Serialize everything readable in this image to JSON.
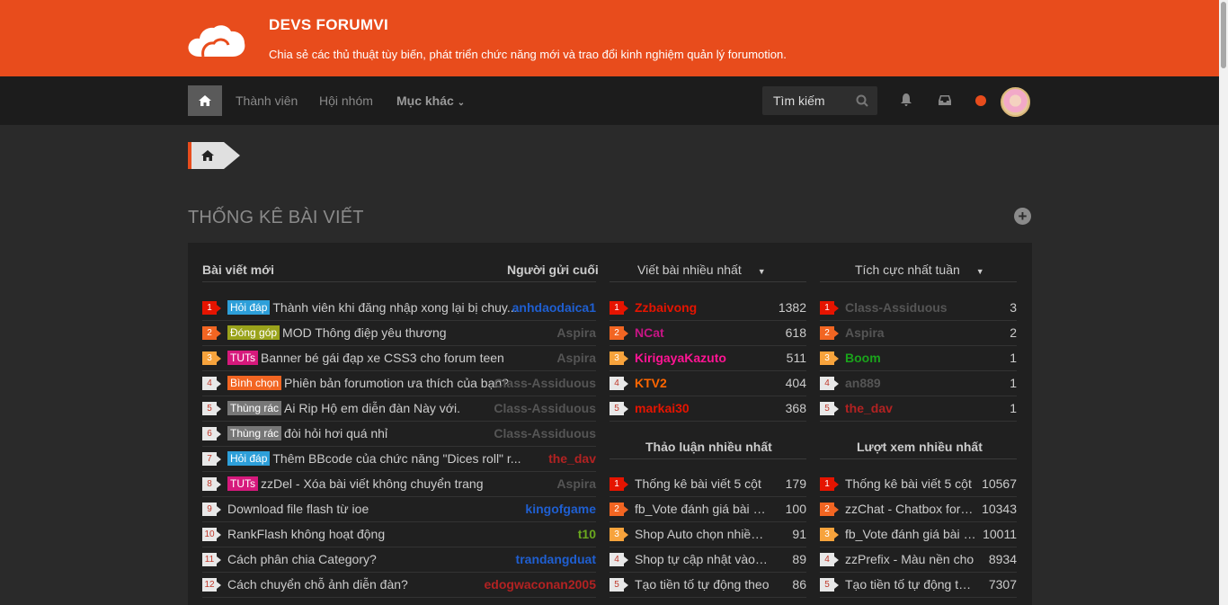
{
  "header": {
    "title": "DEVS FORUMVI",
    "description": "Chia sẻ các thủ thuật tùy biến, phát triển chức năng mới và trao đổi kinh nghiệm quản lý forumotion."
  },
  "nav": {
    "members": "Thành viên",
    "groups": "Hội nhóm",
    "more": "Mục khác",
    "search": "Tìm kiếm"
  },
  "section_title": "THỐNG KÊ BÀI VIẾT",
  "columns": {
    "latest": "Bài viết mới",
    "latest_author": "Người gửi cuối",
    "most_posts": "Viết bài nhiều nhất",
    "active_week": "Tích cực nhất tuần",
    "most_replies": "Thảo luận nhiều nhất",
    "most_views": "Lượt xem nhiều nhất"
  },
  "latest_posts": [
    {
      "n": "1",
      "tag": "Hỏi đáp",
      "tag_color": "#2d9fd9",
      "title": "Thành viên khi đăng nhập xong lại bị chuy...",
      "author": "anhdaodaica1",
      "author_color": "#1f5fd1"
    },
    {
      "n": "2",
      "tag": "Đóng góp",
      "tag_color": "#9aa31b",
      "title": "MOD Thông điệp yêu thương",
      "author": "Aspira",
      "author_color": "#555555"
    },
    {
      "n": "3",
      "tag": "TUTs",
      "tag_color": "#d6197c",
      "title": "Banner bé gái đạp xe CSS3 cho forum teen",
      "author": "Aspira",
      "author_color": "#555555"
    },
    {
      "n": "4",
      "tag": "Bình chọn",
      "tag_color": "#f26522",
      "title": "Phiên bản forumotion ưa thích của bạn?",
      "author": "Class-Assiduous",
      "author_color": "#555555"
    },
    {
      "n": "5",
      "tag": "Thùng rác",
      "tag_color": "#777777",
      "title": "Ai Rip Hộ em diễn đàn Này với.",
      "author": "Class-Assiduous",
      "author_color": "#555555"
    },
    {
      "n": "6",
      "tag": "Thùng rác",
      "tag_color": "#777777",
      "title": "đòi hỏi hơi quá nhỉ",
      "author": "Class-Assiduous",
      "author_color": "#555555"
    },
    {
      "n": "7",
      "tag": "Hỏi đáp",
      "tag_color": "#2d9fd9",
      "title": "Thêm BBcode của chức năng \"Dices roll\" r...",
      "author": "the_dav",
      "author_color": "#b22222"
    },
    {
      "n": "8",
      "tag": "TUTs",
      "tag_color": "#d6197c",
      "title": "zzDel - Xóa bài viết không chuyển trang",
      "author": "Aspira",
      "author_color": "#555555"
    },
    {
      "n": "9",
      "tag": "",
      "tag_color": "",
      "title": "Download file flash từ ioe",
      "author": "kingofgame",
      "author_color": "#1f5fd1"
    },
    {
      "n": "10",
      "tag": "",
      "tag_color": "",
      "title": "RankFlash không hoạt động",
      "author": "t10",
      "author_color": "#6aa81e"
    },
    {
      "n": "11",
      "tag": "",
      "tag_color": "",
      "title": "Cách phân chia Category?",
      "author": "trandangduat",
      "author_color": "#1f5fd1"
    },
    {
      "n": "12",
      "tag": "",
      "tag_color": "",
      "title": "Cách chuyển chỗ ảnh diễn đàn?",
      "author": "edogwaconan2005",
      "author_color": "#b22222"
    }
  ],
  "top_posters": [
    {
      "n": "1",
      "name": "Zzbaivong",
      "color": "#e51400",
      "count": "1382"
    },
    {
      "n": "2",
      "name": "NCat",
      "color": "#c71585",
      "count": "618"
    },
    {
      "n": "3",
      "name": "KirigayaKazuto",
      "color": "#ff1493",
      "count": "511"
    },
    {
      "n": "4",
      "name": "KTV2",
      "color": "#ff6600",
      "count": "404"
    },
    {
      "n": "5",
      "name": "markai30",
      "color": "#e51400",
      "count": "368"
    }
  ],
  "active_week": [
    {
      "n": "1",
      "name": "Class-Assiduous",
      "color": "#555555",
      "count": "3"
    },
    {
      "n": "2",
      "name": "Aspira",
      "color": "#555555",
      "count": "2"
    },
    {
      "n": "3",
      "name": "Boom",
      "color": "#1aa31b",
      "count": "1"
    },
    {
      "n": "4",
      "name": "an889",
      "color": "#555555",
      "count": "1"
    },
    {
      "n": "5",
      "name": "the_dav",
      "color": "#b22222",
      "count": "1"
    }
  ],
  "most_replies": [
    {
      "n": "1",
      "title": "Thống kê bài viết 5 cột",
      "count": "179"
    },
    {
      "n": "2",
      "title": "fb_Vote đánh giá bài viết",
      "count": "100"
    },
    {
      "n": "3",
      "title": "Shop Auto chọn nhiều món",
      "count": "91"
    },
    {
      "n": "4",
      "title": "Shop tự cập nhật vào ngăn",
      "count": "89"
    },
    {
      "n": "5",
      "title": "Tạo tiền tố tự động theo",
      "count": "86"
    }
  ],
  "most_views": [
    {
      "n": "1",
      "title": "Thống kê bài viết 5 cột",
      "count": "10567"
    },
    {
      "n": "2",
      "title": "zzChat - Chatbox forum",
      "count": "10343"
    },
    {
      "n": "3",
      "title": "fb_Vote đánh giá bài viết",
      "count": "10011"
    },
    {
      "n": "4",
      "title": "zzPrefix - Màu nền cho",
      "count": "8934"
    },
    {
      "n": "5",
      "title": "Tạo tiền tố tự động theo",
      "count": "7307"
    }
  ]
}
